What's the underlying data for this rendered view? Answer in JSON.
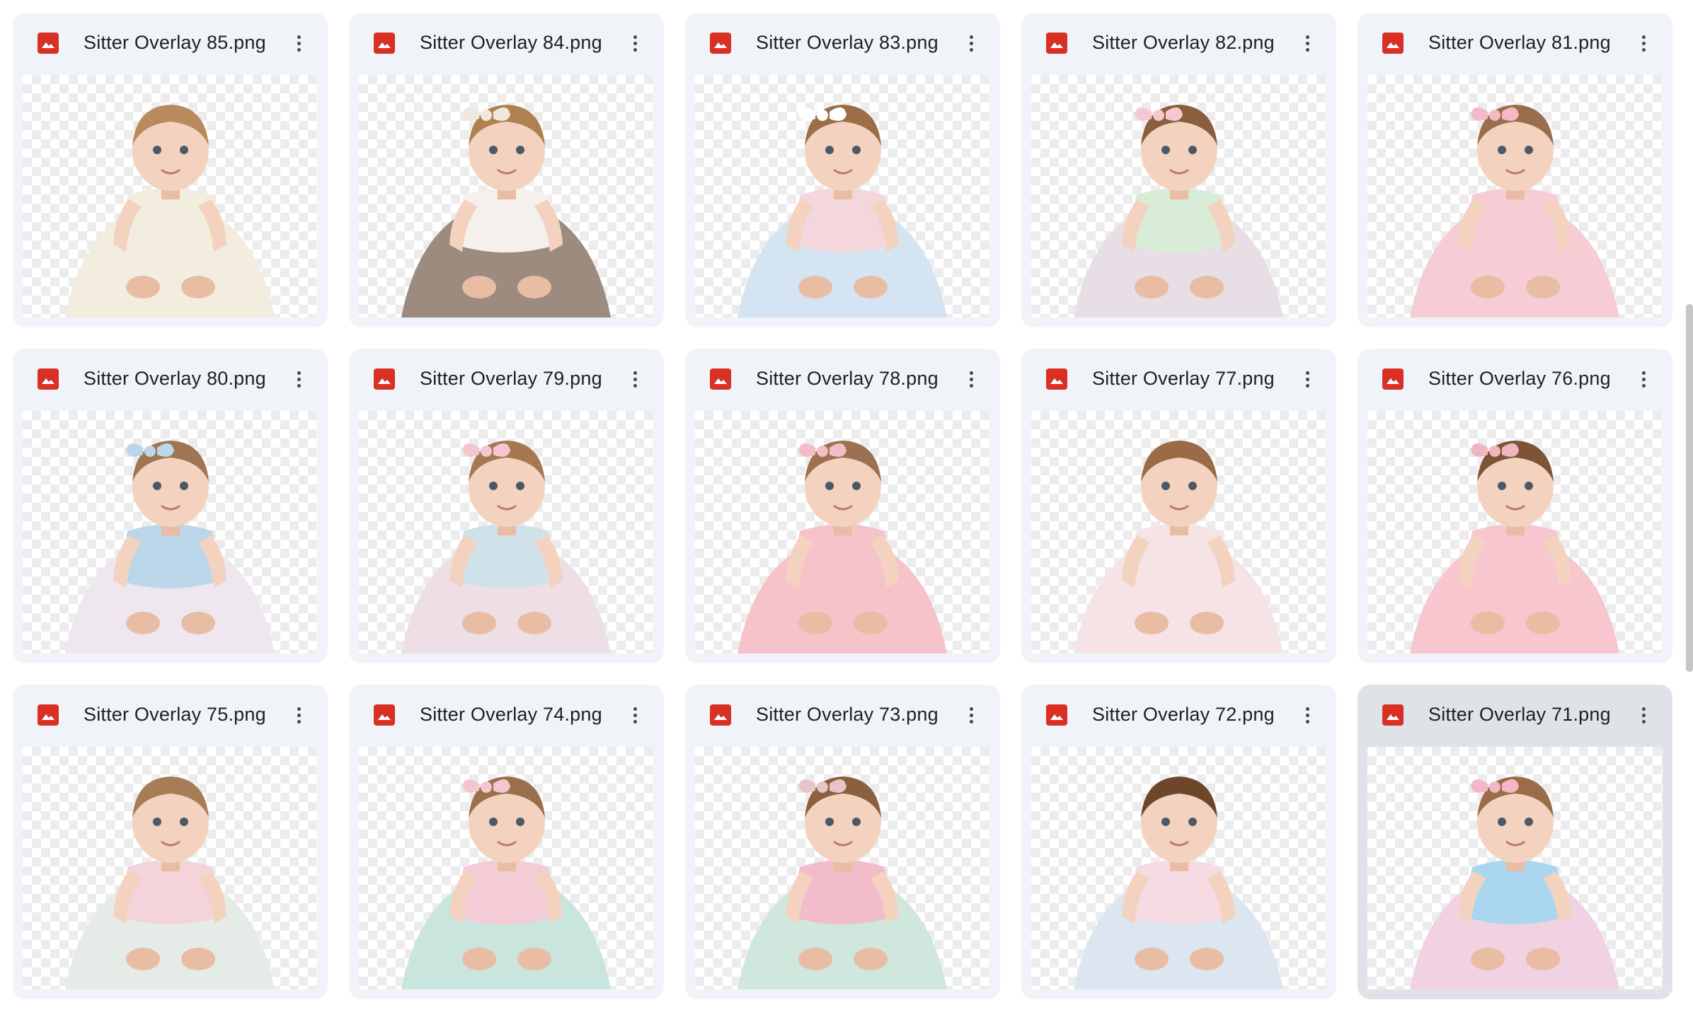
{
  "files": [
    {
      "name": "Sitter Overlay 85.png",
      "dress": "#f3ede0",
      "accent": "#f3ede0",
      "hair": "#b88a5e",
      "bow": ""
    },
    {
      "name": "Sitter Overlay 84.png",
      "dress": "#9c8b7e",
      "accent": "#f4f1ec",
      "hair": "#b08150",
      "bow": "#efe8e0"
    },
    {
      "name": "Sitter Overlay 83.png",
      "dress": "#d4e4f2",
      "accent": "#f4d7dd",
      "hair": "#9b6e48",
      "bow": "#ffffff"
    },
    {
      "name": "Sitter Overlay 82.png",
      "dress": "#e8dfe6",
      "accent": "#d8ecd8",
      "hair": "#8a5e3e",
      "bow": "#f6c9d0"
    },
    {
      "name": "Sitter Overlay 81.png",
      "dress": "#f6cdd4",
      "accent": "#f6cdd4",
      "hair": "#9a6e4c",
      "bow": "#f4b9c4"
    },
    {
      "name": "Sitter Overlay 80.png",
      "dress": "#eee7ef",
      "accent": "#bcd7ea",
      "hair": "#a07552",
      "bow": "#bcd7ea"
    },
    {
      "name": "Sitter Overlay 79.png",
      "dress": "#eedfe6",
      "accent": "#cfe2ea",
      "hair": "#a57852",
      "bow": "#f4c6cf"
    },
    {
      "name": "Sitter Overlay 78.png",
      "dress": "#f7c3cb",
      "accent": "#f7c3cb",
      "hair": "#9c7050",
      "bow": "#f4bcc6"
    },
    {
      "name": "Sitter Overlay 77.png",
      "dress": "#f6e3e5",
      "accent": "#f6e3e5",
      "hair": "#9a6b46",
      "bow": ""
    },
    {
      "name": "Sitter Overlay 76.png",
      "dress": "#f7c6cf",
      "accent": "#f7c6cf",
      "hair": "#7e5436",
      "bow": "#f0b6c0"
    },
    {
      "name": "Sitter Overlay 75.png",
      "dress": "#e5ebe6",
      "accent": "#f4d3da",
      "hair": "#a77c56",
      "bow": ""
    },
    {
      "name": "Sitter Overlay 74.png",
      "dress": "#c9e5de",
      "accent": "#f3ccd6",
      "hair": "#9b6f4c",
      "bow": "#f3c6d0"
    },
    {
      "name": "Sitter Overlay 73.png",
      "dress": "#cfe7dc",
      "accent": "#f2bccb",
      "hair": "#8c603f",
      "bow": "#e8c3c8"
    },
    {
      "name": "Sitter Overlay 72.png",
      "dress": "#dbe6f1",
      "accent": "#f6dbe2",
      "hair": "#6e462b",
      "bow": ""
    },
    {
      "name": "Sitter Overlay 71.png",
      "dress": "#f1d2e3",
      "accent": "#a9d7ef",
      "hair": "#9b6c48",
      "bow": "#f4b7c6"
    }
  ],
  "icons": {
    "file_type": "image-file-icon",
    "more": "more-vert-icon"
  },
  "colors": {
    "file_icon": "#d93025",
    "card_bg": "#f0f4f9",
    "card_selected_bg": "#dfe3e8"
  },
  "selected_index": 14
}
